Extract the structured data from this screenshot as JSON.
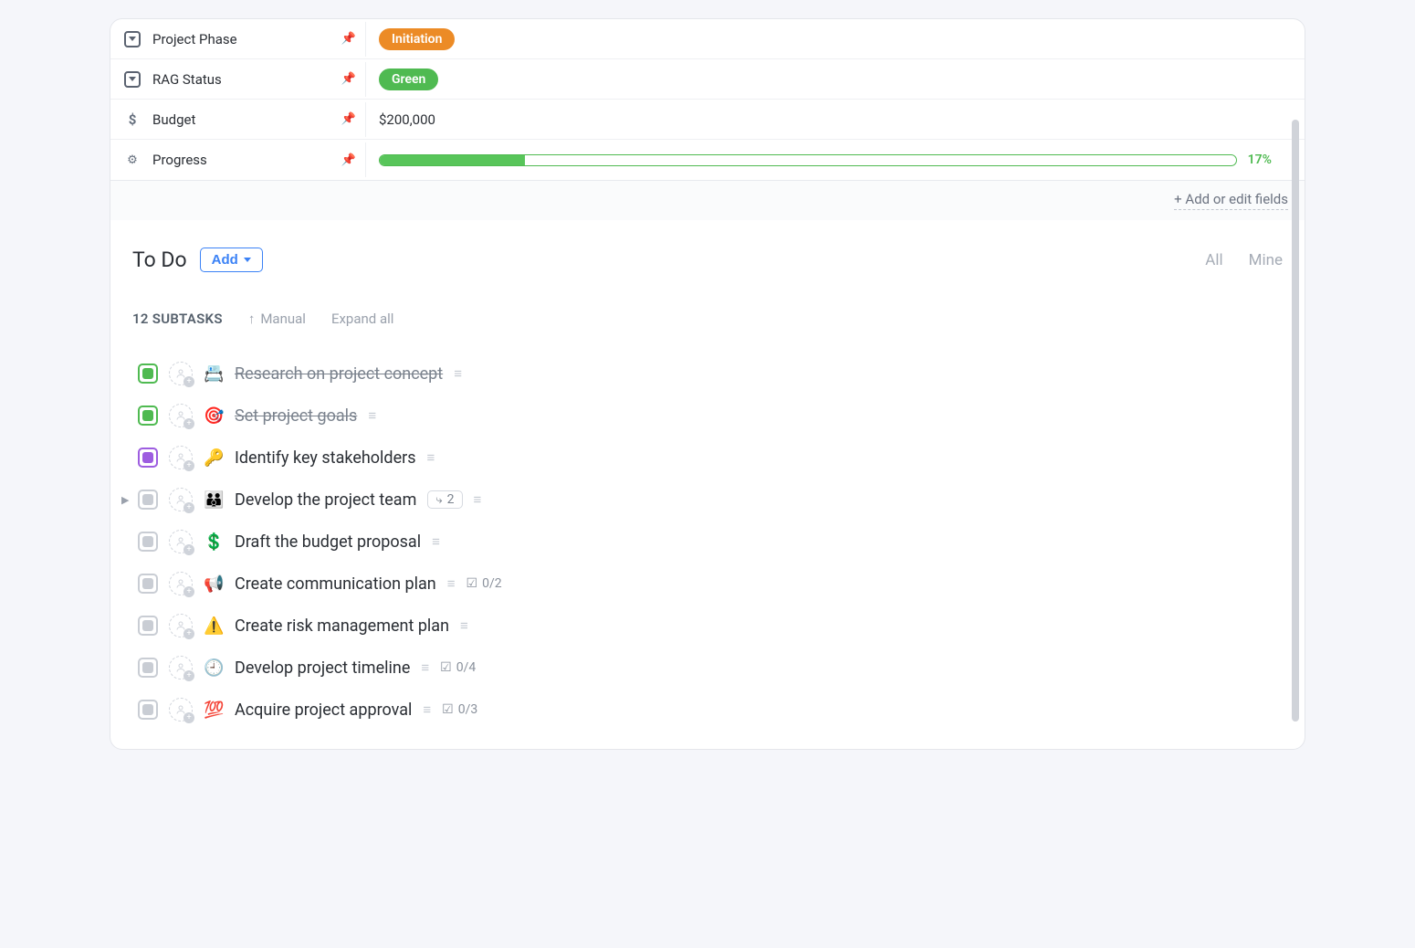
{
  "fields": {
    "phase": {
      "label": "Project Phase",
      "value": "Initiation",
      "color": "orange"
    },
    "rag": {
      "label": "RAG Status",
      "value": "Green",
      "color": "green"
    },
    "budget": {
      "label": "Budget",
      "value": "$200,000"
    },
    "progress": {
      "label": "Progress",
      "pct": 17,
      "pct_text": "17%"
    },
    "add_edit": "+ Add or edit fields"
  },
  "section": {
    "title": "To Do",
    "add_label": "Add",
    "filter_all": "All",
    "filter_mine": "Mine",
    "count_label": "12 SUBTASKS",
    "sort_label": "Manual",
    "expand_label": "Expand all"
  },
  "tasks": [
    {
      "emoji": "📇",
      "title": "Research on project concept",
      "status": "done"
    },
    {
      "emoji": "🎯",
      "title": "Set project goals",
      "status": "done"
    },
    {
      "emoji": "🔑",
      "title": "Identify key stakeholders",
      "status": "purple"
    },
    {
      "emoji": "👪",
      "title": "Develop the project team",
      "status": "gray",
      "subtask_count": "2",
      "has_children": true
    },
    {
      "emoji": "💲",
      "title": "Draft the budget proposal",
      "status": "gray"
    },
    {
      "emoji": "📢",
      "title": "Create communication plan",
      "status": "gray",
      "checklist": "0/2"
    },
    {
      "emoji": "⚠️",
      "title": "Create risk management plan",
      "status": "gray"
    },
    {
      "emoji": "🕘",
      "title": "Develop project timeline",
      "status": "gray",
      "checklist": "0/4"
    },
    {
      "emoji": "💯",
      "title": "Acquire project approval",
      "status": "gray",
      "checklist": "0/3"
    }
  ]
}
